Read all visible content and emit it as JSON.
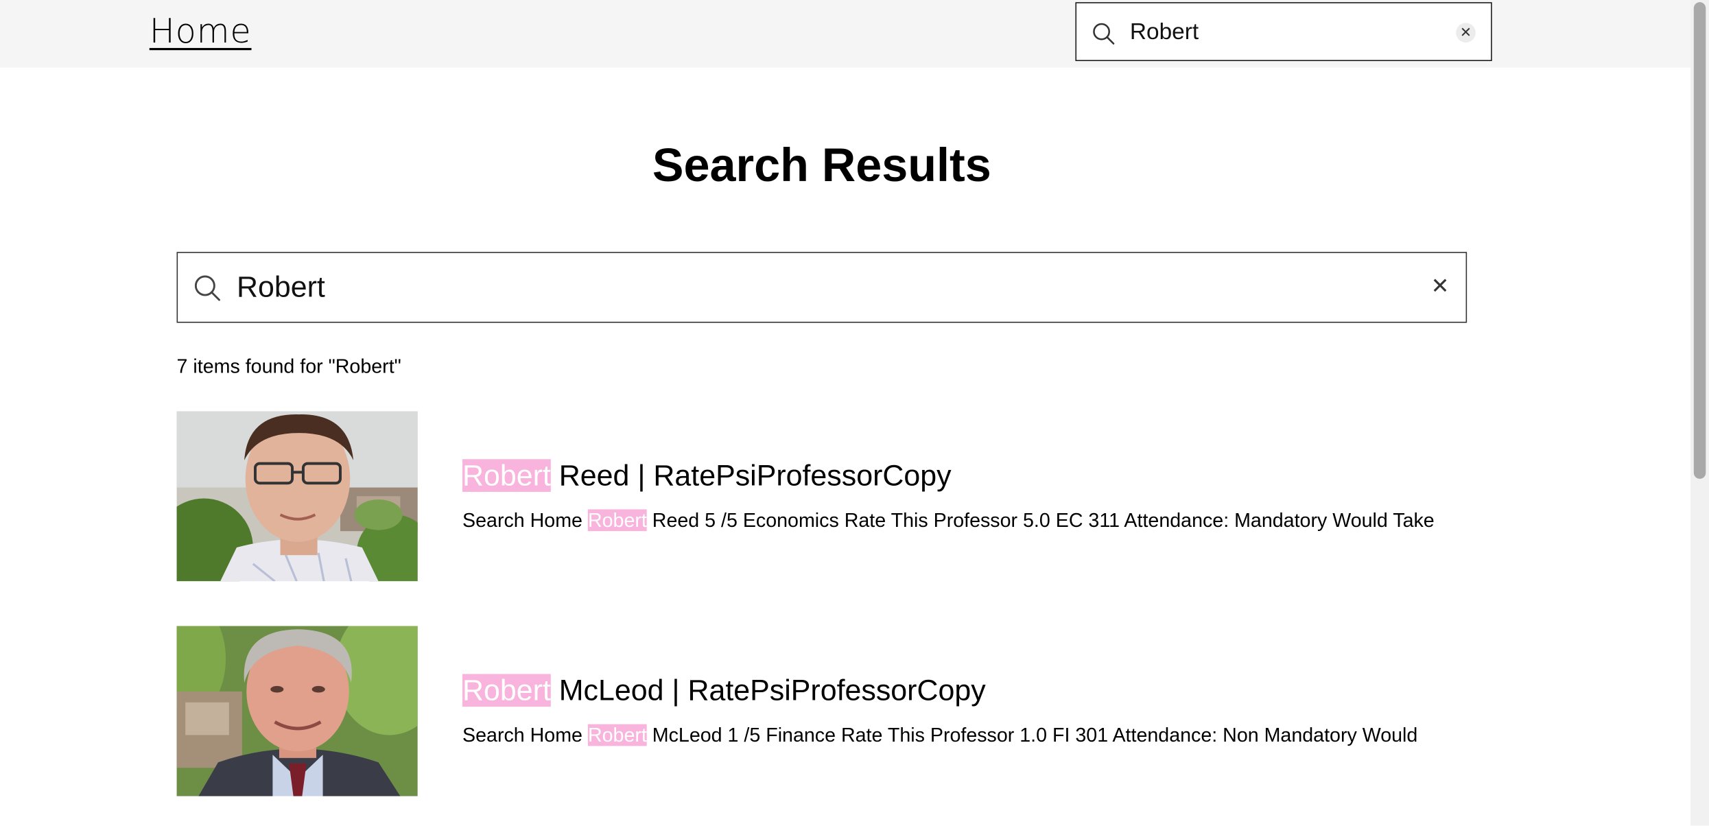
{
  "header": {
    "home_label": "Home",
    "search_value": "Robert",
    "clear_glyph": "✕"
  },
  "main": {
    "title": "Search Results",
    "search_value": "Robert",
    "clear_glyph": "✕",
    "results_count": "7 items found for \"Robert\""
  },
  "results": [
    {
      "highlight": "Robert",
      "title_rest": " Reed | RatePsiProfessorCopy",
      "snippet_prefix": "Search Home ",
      "snippet_highlight": "Robert",
      "snippet_rest": " Reed 5 /5 Economics Rate This Professor 5.0 EC 311 Attendance: Mandatory Would Take"
    },
    {
      "highlight": "Robert",
      "title_rest": " McLeod | RatePsiProfessorCopy",
      "snippet_prefix": "Search Home ",
      "snippet_highlight": "Robert",
      "snippet_rest": " McLeod 1 /5 Finance Rate This Professor 1.0 FI 301 Attendance: Non Mandatory Would"
    }
  ],
  "icons": {
    "search": "search-icon",
    "clear": "close-icon"
  },
  "colors": {
    "highlight": "#f8b4dc",
    "topbar": "#f5f5f5"
  }
}
